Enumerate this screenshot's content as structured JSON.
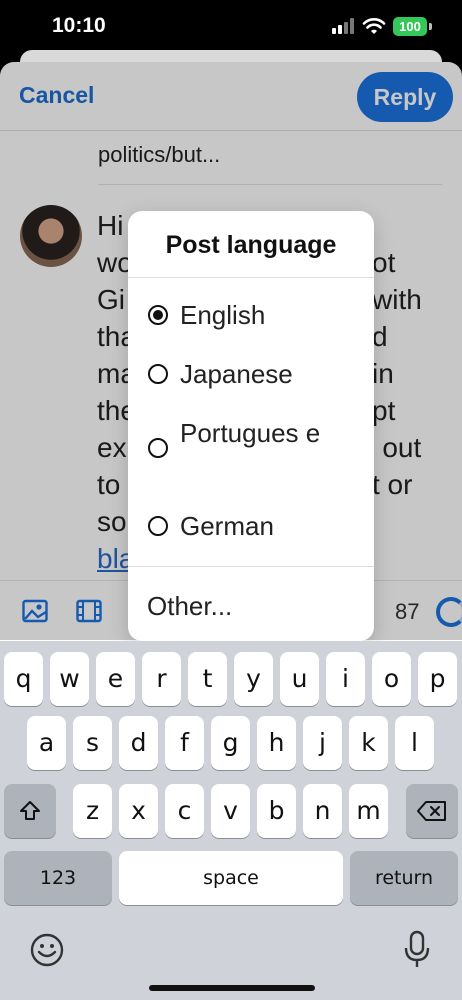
{
  "status": {
    "time": "10:10",
    "battery": "100"
  },
  "header": {
    "cancel_label": "Cancel",
    "reply_label": "Reply"
  },
  "quoted": {
    "text_line": "politics/but..."
  },
  "compose": {
    "lines": [
      "Hi",
      "wo",
      "Gi",
      "tha",
      "ma",
      "the",
      "ex",
      "to",
      "so",
      "bla"
    ],
    "right_fragments": [
      "ot",
      "with",
      "d",
      "in",
      "pt",
      "n out",
      "t or"
    ]
  },
  "toolbar": {
    "char_count": "87"
  },
  "language_menu": {
    "title": "Post language",
    "options": [
      {
        "label": "English",
        "selected": true
      },
      {
        "label": "Japanese",
        "selected": false
      },
      {
        "label": "Portugues e",
        "selected": false
      },
      {
        "label": "German",
        "selected": false
      }
    ],
    "other_label": "Other..."
  },
  "keyboard": {
    "row1": [
      "q",
      "w",
      "e",
      "r",
      "t",
      "y",
      "u",
      "i",
      "o",
      "p"
    ],
    "row2": [
      "a",
      "s",
      "d",
      "f",
      "g",
      "h",
      "j",
      "k",
      "l"
    ],
    "row3": [
      "z",
      "x",
      "c",
      "v",
      "b",
      "n",
      "m"
    ],
    "numbers_label": "123",
    "space_label": "space",
    "return_label": "return"
  },
  "colors": {
    "accent": "#1d74e2",
    "battery": "#34c759"
  }
}
